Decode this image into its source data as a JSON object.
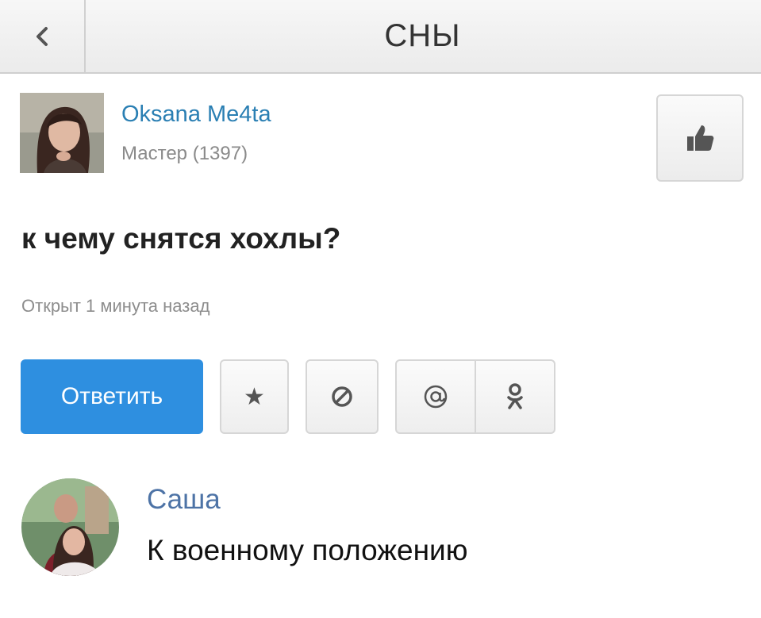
{
  "header": {
    "title": "СНЫ",
    "back_icon": "chevron-left-icon"
  },
  "author": {
    "name": "Oksana Me4ta",
    "rank": "Мастер (1397)"
  },
  "like_icon": "thumbs-up-icon",
  "question": {
    "text": "к чему снятся хохлы?",
    "opened": "Открыт 1 минута назад"
  },
  "actions": {
    "reply_label": "Ответить",
    "star_glyph": "★",
    "icons": [
      "star-icon",
      "block-icon",
      "at-icon",
      "odnoklassniki-icon"
    ]
  },
  "comment": {
    "author": "Саша",
    "text": "К военному положению"
  },
  "colors": {
    "link": "#2a7fb3",
    "reply_button": "#2e8fe0",
    "commenter_name": "#4d73a6"
  }
}
